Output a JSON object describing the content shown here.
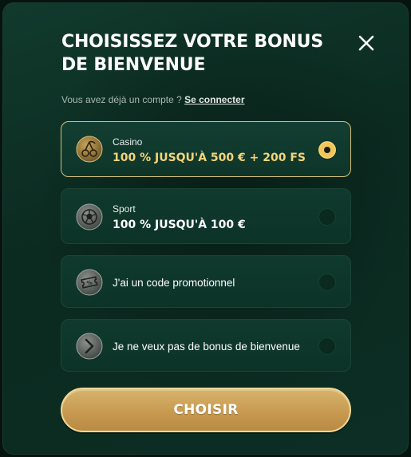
{
  "modal": {
    "title": "CHOISISSEZ VOTRE BONUS DE BIENVENUE",
    "subtitle": "Vous avez déjà un compte ?",
    "login_link": "Se connecter",
    "close_icon": "close-icon"
  },
  "options": [
    {
      "category": "Casino",
      "value": "100 % JUSQU'À 500 € + 200 FS",
      "icon": "cherry-icon",
      "selected": true
    },
    {
      "category": "Sport",
      "value": "100 % JUSQU'À 100 €",
      "icon": "soccer-ball-icon",
      "selected": false
    },
    {
      "label": "J'ai un code promotionnel",
      "icon": "promo-ticket-icon",
      "selected": false
    },
    {
      "label": "Je ne veux pas de bonus de bienvenue",
      "icon": "chevron-right-icon",
      "selected": false
    }
  ],
  "cta": {
    "label": "CHOISIR"
  },
  "colors": {
    "accent": "#f0c55a",
    "background": "#0b2a20",
    "button": "#c89a51"
  }
}
